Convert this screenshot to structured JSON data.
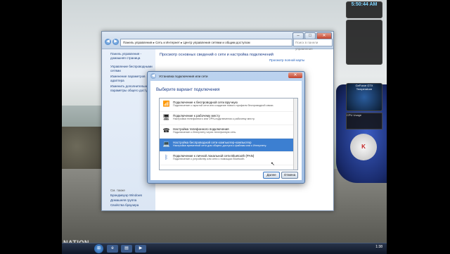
{
  "window_title": "Центр управления сетями и общим доступом",
  "explorer": {
    "address": "Панель управления ▸ Сеть и Интернет ▸ Центр управления сетями и общим доступом",
    "search_placeholder": "Поиск в панели управления",
    "left_pane": {
      "home_link": "Панель управления - домашняя страница",
      "links": [
        "Управление беспроводными сетями",
        "Изменение параметров адаптера",
        "Изменить дополнительные параметры общего доступа"
      ],
      "see_also_label": "См. также",
      "see_also": [
        "Брандмауэр Windows",
        "Домашняя группа",
        "Свойства браузера"
      ]
    },
    "main_title": "Просмотр основных сведений о сети и настройка подключений",
    "map_link": "Просмотр полной карты"
  },
  "dialog": {
    "title": "Установка подключения или сети",
    "heading": "Выберите вариант подключения",
    "options": [
      {
        "title": "Подключение к беспроводной сети вручную",
        "desc": "Подключение к скрытой сети или создание нового профиля беспроводной связи.",
        "icon": "wireless-icon",
        "selected": false
      },
      {
        "title": "Подключение к рабочему месту",
        "desc": "Настройка телефонного или VPN-подключения к рабочему месту.",
        "icon": "workplace-icon",
        "selected": false
      },
      {
        "title": "Настройка телефонного подключения",
        "desc": "Подключение к Интернету через телефонную сеть.",
        "icon": "dialup-icon",
        "selected": false
      },
      {
        "title": "Настройка беспроводной сети компьютер-компьютер",
        "desc": "Настройка временной сети для общего доступа к файлам или к Интернету.",
        "icon": "adhoc-icon",
        "selected": true
      },
      {
        "title": "Подключение к личной локальной сети Bluetooth (PAN)",
        "desc": "Подключение к устройству или сети с помощью Bluetooth.",
        "icon": "bluetooth-icon",
        "selected": false
      }
    ],
    "next_label": "Далее",
    "cancel_label": "Отмена"
  },
  "gadgets": {
    "clock_time": "5:50:44 AM",
    "gpu_label": "GeForce GTX",
    "gpu_temp_label": "Temperature",
    "cpu_label": "CPU Usage"
  },
  "taskbar": {
    "time": "1:38"
  }
}
